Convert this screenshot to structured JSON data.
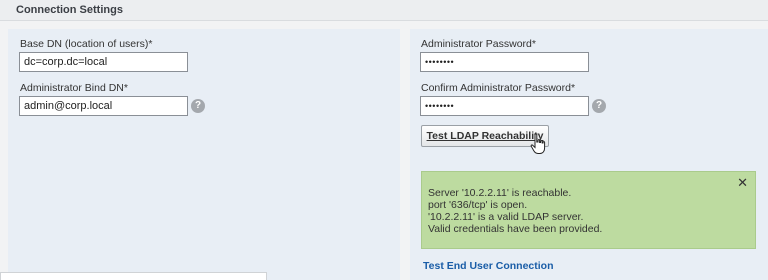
{
  "section": {
    "title": "Connection Settings"
  },
  "left": {
    "base_dn": {
      "label": "Base DN (location of users)*",
      "value": "dc=corp.dc=local"
    },
    "bind_dn": {
      "label": "Administrator Bind DN*",
      "value": "admin@corp.local"
    }
  },
  "right": {
    "password": {
      "label": "Administrator Password*",
      "value": "••••••••"
    },
    "confirm_password": {
      "label": "Confirm Administrator Password*",
      "value": "••••••••"
    },
    "test_button": {
      "label": "Test LDAP Reachability"
    },
    "alert": {
      "lines": [
        "Server '10.2.2.11' is reachable.",
        "port '636/tcp' is open.",
        "'10.2.2.11' is a valid LDAP server.",
        "Valid credentials have been provided."
      ],
      "close_glyph": "✕",
      "bg_color": "#bddba0"
    },
    "test_user_link": "Test End User Connection"
  },
  "icons": {
    "help_glyph": "?",
    "help": "help-icon",
    "cursor": "hand-cursor-icon"
  }
}
